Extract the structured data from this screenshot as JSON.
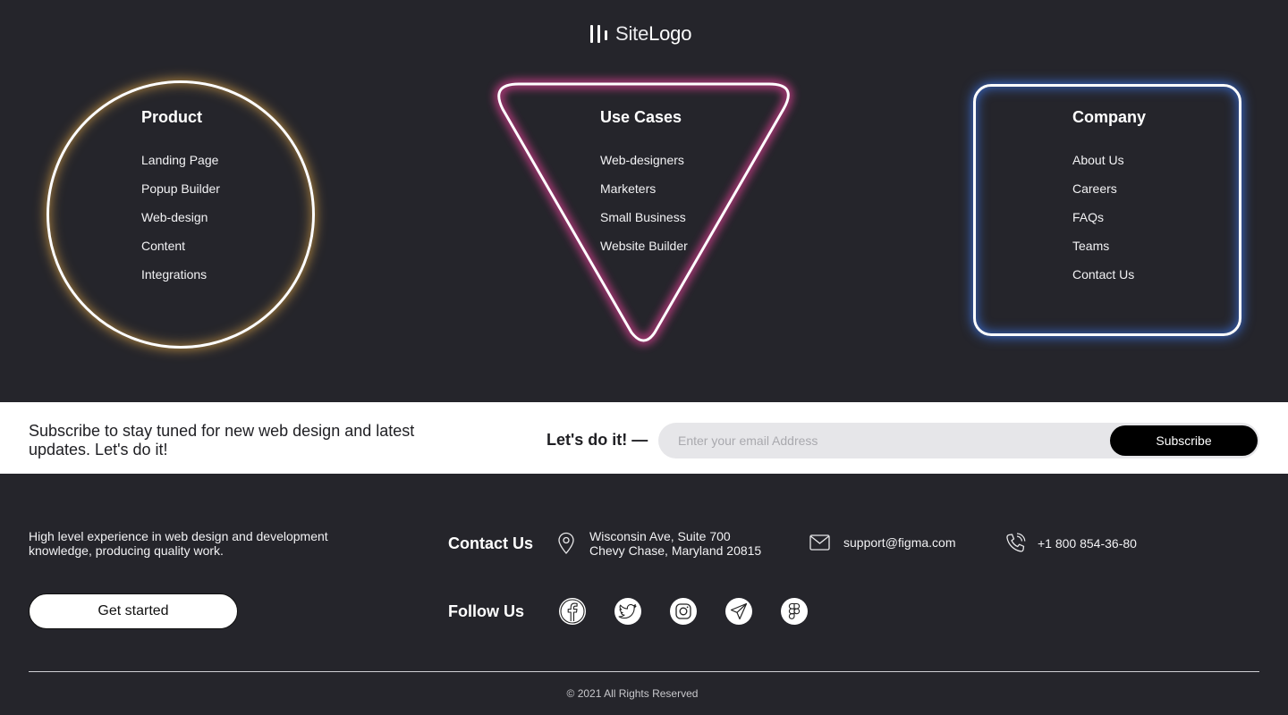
{
  "logo": {
    "light": "Site",
    "bold": "Logo"
  },
  "colors": {
    "background": "#25252b",
    "circle_glow": "#e8ab49",
    "triangle_glow": "#d23c8c",
    "square_glow": "#4080ff"
  },
  "columns": {
    "product": {
      "title": "Product",
      "links": [
        "Landing Page",
        "Popup Builder",
        "Web-design",
        "Content",
        "Integrations"
      ]
    },
    "use_cases": {
      "title": "Use Cases",
      "links": [
        "Web-designers",
        "Marketers",
        "Small Business",
        "Website Builder"
      ]
    },
    "company": {
      "title": "Company",
      "links": [
        "About Us",
        "Careers",
        "FAQs",
        "Teams",
        "Contact Us"
      ]
    }
  },
  "subscribe": {
    "text": "Subscribe to stay tuned for new web design and latest updates. Let's do it!",
    "lets_do_it": "Let's do it! —",
    "placeholder": "Enter your email Address",
    "button": "Subscribe"
  },
  "footer": {
    "tagline": "High level experience in web design and development knowledge, producing quality work.",
    "get_started": "Get started",
    "contact_heading": "Contact Us",
    "address_line1": "Wisconsin Ave, Suite 700",
    "address_line2": "Chevy Chase, Maryland 20815",
    "email": "support@figma.com",
    "phone": "+1 800 854-36-80",
    "follow_heading": "Follow Us",
    "socials": [
      "facebook-icon",
      "twitter-icon",
      "instagram-icon",
      "telegram-icon",
      "figma-icon"
    ],
    "copyright": "© 2021 All Rights Reserved"
  }
}
